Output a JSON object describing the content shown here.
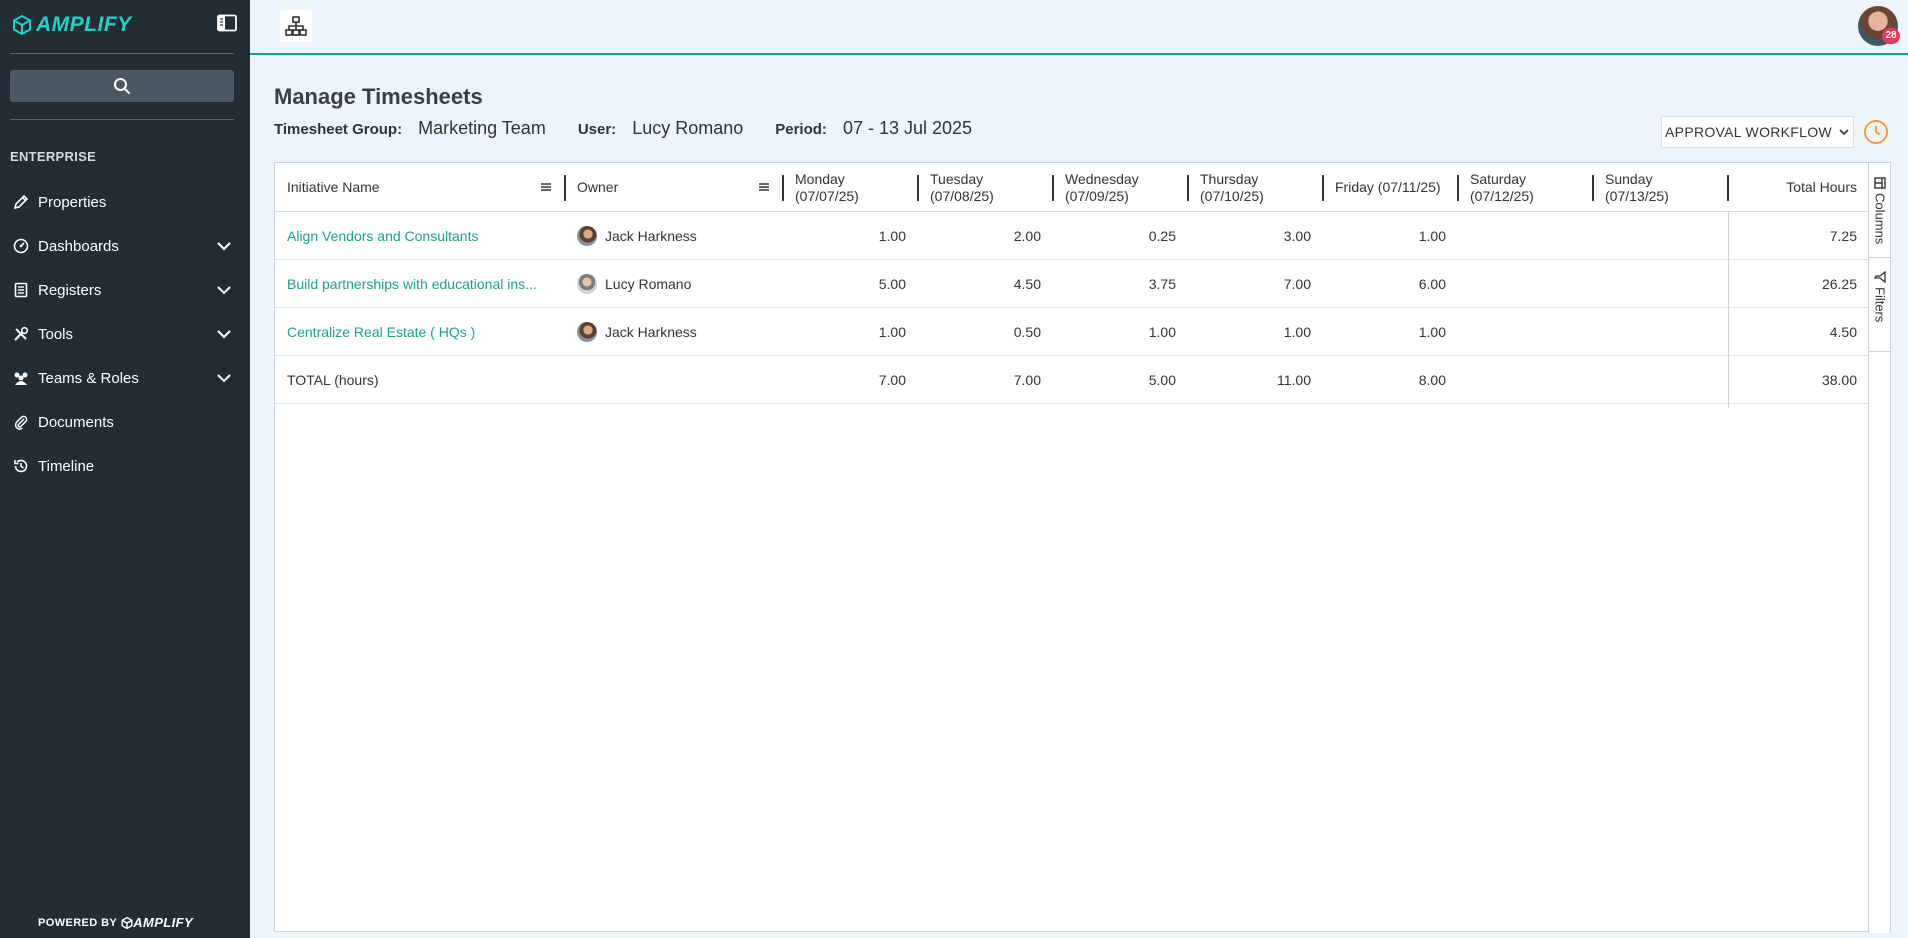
{
  "app": {
    "brand": "AMPLIFY",
    "powered_by": "POWERED BY",
    "powered_brand": "AMPLIFY"
  },
  "sidebar": {
    "section": "ENTERPRISE",
    "items": [
      {
        "label": "Properties",
        "icon": "pencil-icon",
        "expandable": false
      },
      {
        "label": "Dashboards",
        "icon": "dashboard-icon",
        "expandable": true
      },
      {
        "label": "Registers",
        "icon": "register-icon",
        "expandable": true
      },
      {
        "label": "Tools",
        "icon": "tools-icon",
        "expandable": true
      },
      {
        "label": "Teams & Roles",
        "icon": "team-icon",
        "expandable": true
      },
      {
        "label": "Documents",
        "icon": "paperclip-icon",
        "expandable": false
      },
      {
        "label": "Timeline",
        "icon": "history-icon",
        "expandable": false
      }
    ]
  },
  "topbar": {
    "notification_count": "28"
  },
  "page": {
    "title": "Manage Timesheets",
    "group_label": "Timesheet Group:",
    "group_value": "Marketing Team",
    "user_label": "User:",
    "user_value": "Lucy Romano",
    "period_label": "Period:",
    "period_value": "07 - 13 Jul 2025",
    "approval_button": "APPROVAL WORKFLOW"
  },
  "grid": {
    "columns": {
      "initiative": "Initiative Name",
      "owner": "Owner",
      "mon": [
        "Monday",
        "(07/07/25)"
      ],
      "tue": [
        "Tuesday",
        "(07/08/25)"
      ],
      "wed": [
        "Wednesday",
        "(07/09/25)"
      ],
      "thu": [
        "Thursday",
        "(07/10/25)"
      ],
      "fri": "Friday (07/11/25)",
      "sat": [
        "Saturday",
        "(07/12/25)"
      ],
      "sun": [
        "Sunday",
        "(07/13/25)"
      ],
      "total": "Total Hours"
    },
    "rows": [
      {
        "name": "Align Vendors and Consultants",
        "owner": "Jack Harkness",
        "mon": "1.00",
        "tue": "2.00",
        "wed": "0.25",
        "thu": "3.00",
        "fri": "1.00",
        "sat": "",
        "sun": "",
        "total": "7.25"
      },
      {
        "name": "Build partnerships with educational ins...",
        "owner": "Lucy Romano",
        "mon": "5.00",
        "tue": "4.50",
        "wed": "3.75",
        "thu": "7.00",
        "fri": "6.00",
        "sat": "",
        "sun": "",
        "total": "26.25"
      },
      {
        "name": "Centralize Real Estate ( HQs )",
        "owner": "Jack Harkness",
        "mon": "1.00",
        "tue": "0.50",
        "wed": "1.00",
        "thu": "1.00",
        "fri": "1.00",
        "sat": "",
        "sun": "",
        "total": "4.50"
      }
    ],
    "totals": {
      "label": "TOTAL (hours)",
      "mon": "7.00",
      "tue": "7.00",
      "wed": "5.00",
      "thu": "11.00",
      "fri": "8.00",
      "sat": "",
      "sun": "",
      "total": "38.00"
    },
    "side_tabs": {
      "columns": "Columns",
      "filters": "Filters"
    }
  },
  "colors": {
    "accent": "#1a9e8f",
    "sidebar_bg": "#232d36",
    "badge": "#e8365d",
    "clock": "#f29b38"
  }
}
